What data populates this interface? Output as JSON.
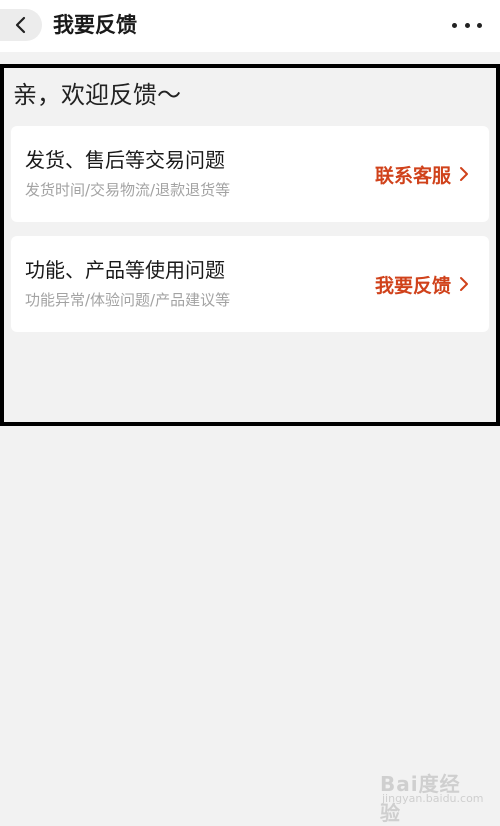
{
  "header": {
    "title": "我要反馈",
    "back_icon": "chevron-left-icon",
    "more_icon": "more-horizontal-icon"
  },
  "greeting": "亲，欢迎反馈～",
  "cards": [
    {
      "title": "发货、售后等交易问题",
      "subtitle": "发货时间/交易物流/退款退货等",
      "action": "联系客服"
    },
    {
      "title": "功能、产品等使用问题",
      "subtitle": "功能异常/体验问题/产品建议等",
      "action": "我要反馈"
    }
  ],
  "colors": {
    "accent": "#d0421b",
    "background": "#f2f2f2",
    "card": "#ffffff"
  },
  "watermark": {
    "main": "Bai度经验",
    "sub": "jingyan.baidu.com"
  }
}
